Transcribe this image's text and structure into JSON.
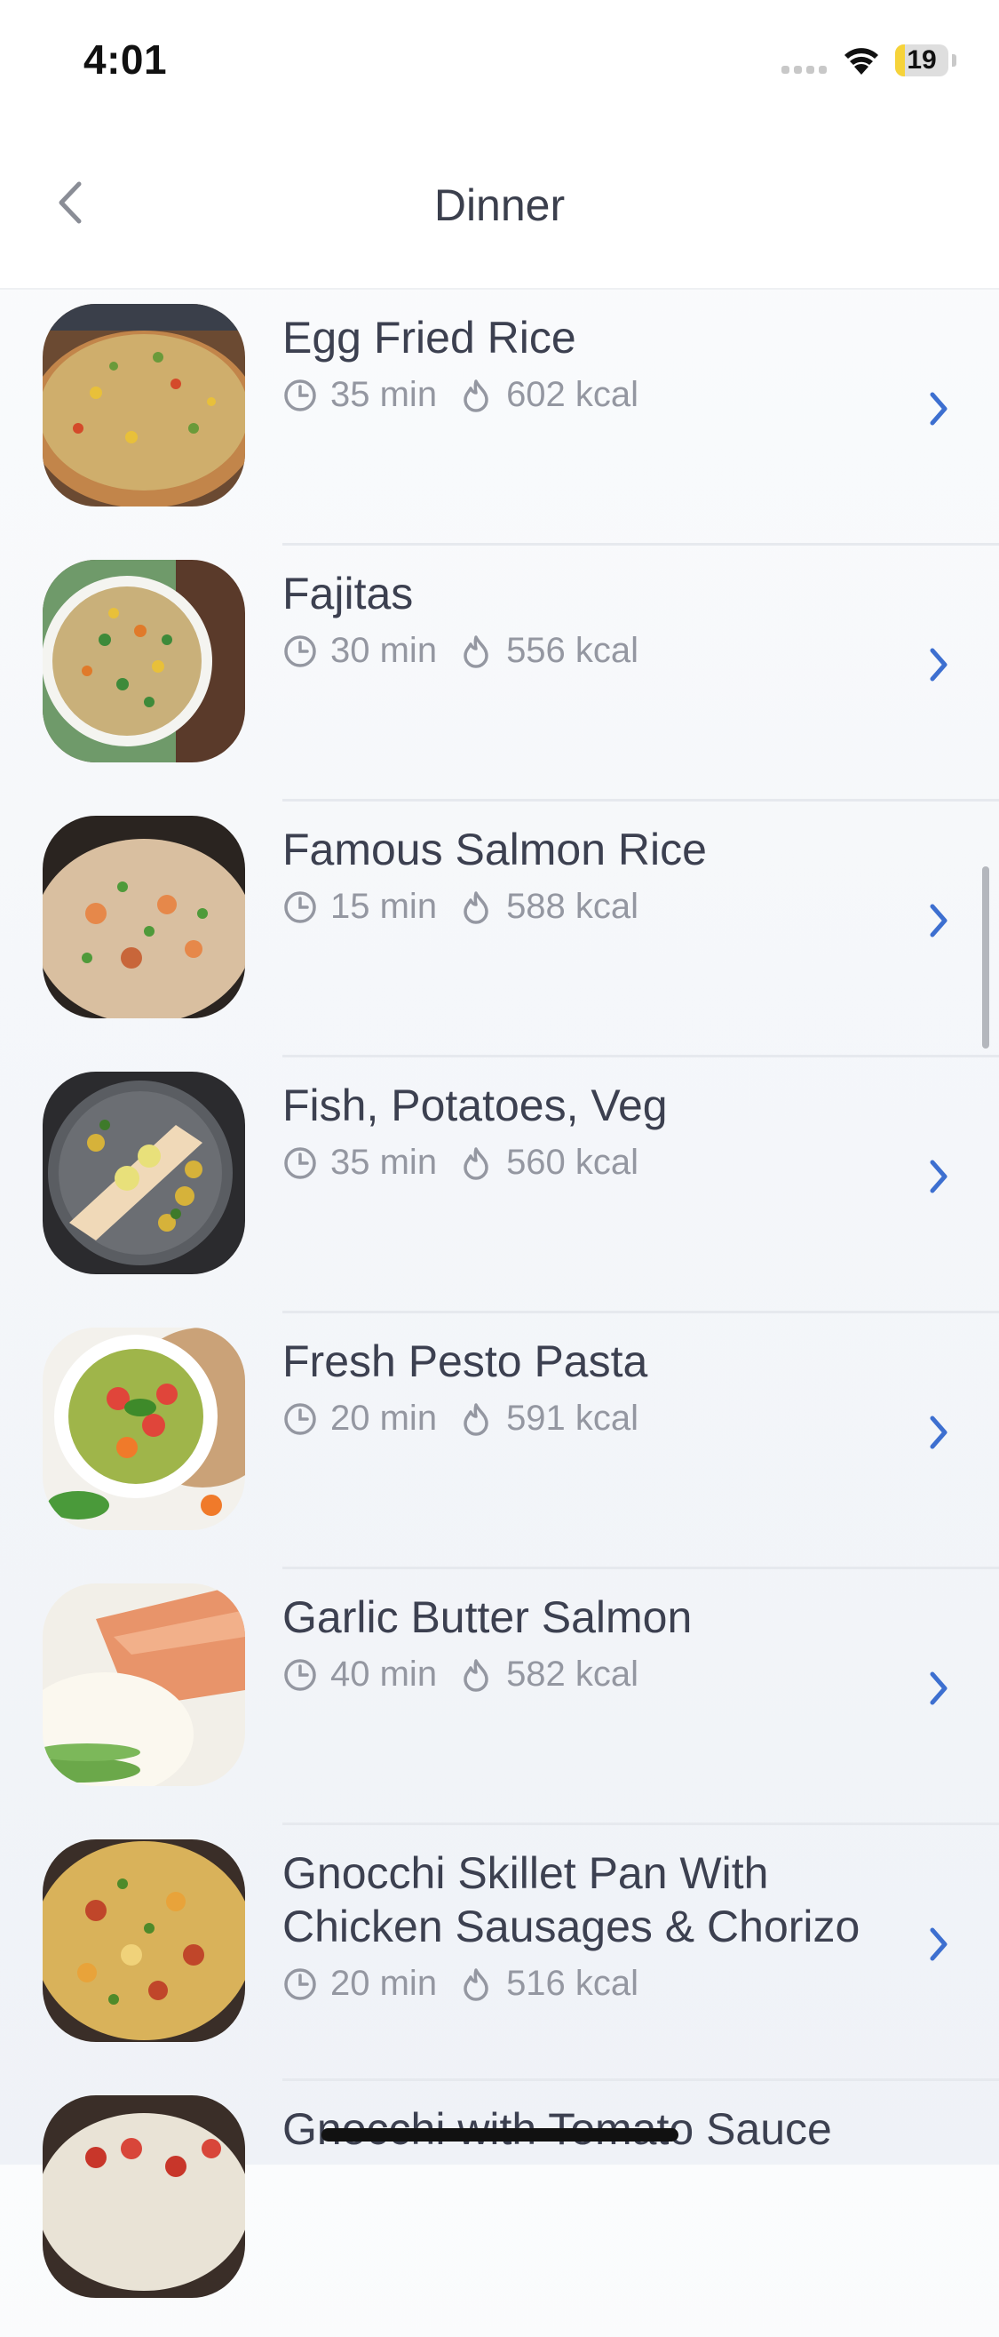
{
  "status_bar": {
    "time": "4:01",
    "battery": "19"
  },
  "nav": {
    "title": "Dinner",
    "back_icon": "chevron-left-icon"
  },
  "icons": {
    "time": "clock-icon",
    "calories": "flame-icon",
    "row_chevron": "chevron-right-icon"
  },
  "colors": {
    "accent": "#3d6fd0",
    "title_text": "#3c4050",
    "meta_text": "#9497a1",
    "battery": "#f6d33a"
  },
  "recipes": [
    {
      "name": "Egg Fried Rice",
      "time": "35 min",
      "calories": "602 kcal"
    },
    {
      "name": "Fajitas",
      "time": "30 min",
      "calories": "556 kcal"
    },
    {
      "name": "Famous Salmon Rice",
      "time": "15 min",
      "calories": "588 kcal"
    },
    {
      "name": "Fish, Potatoes, Veg",
      "time": "35 min",
      "calories": "560 kcal"
    },
    {
      "name": "Fresh Pesto Pasta",
      "time": "20 min",
      "calories": "591 kcal"
    },
    {
      "name": "Garlic Butter Salmon",
      "time": "40 min",
      "calories": "582 kcal"
    },
    {
      "name": "Gnocchi Skillet Pan With Chicken Sausages & Chorizo",
      "time": "20 min",
      "calories": "516 kcal"
    },
    {
      "name": "Gnocchi with Tomato Sauce"
    }
  ]
}
